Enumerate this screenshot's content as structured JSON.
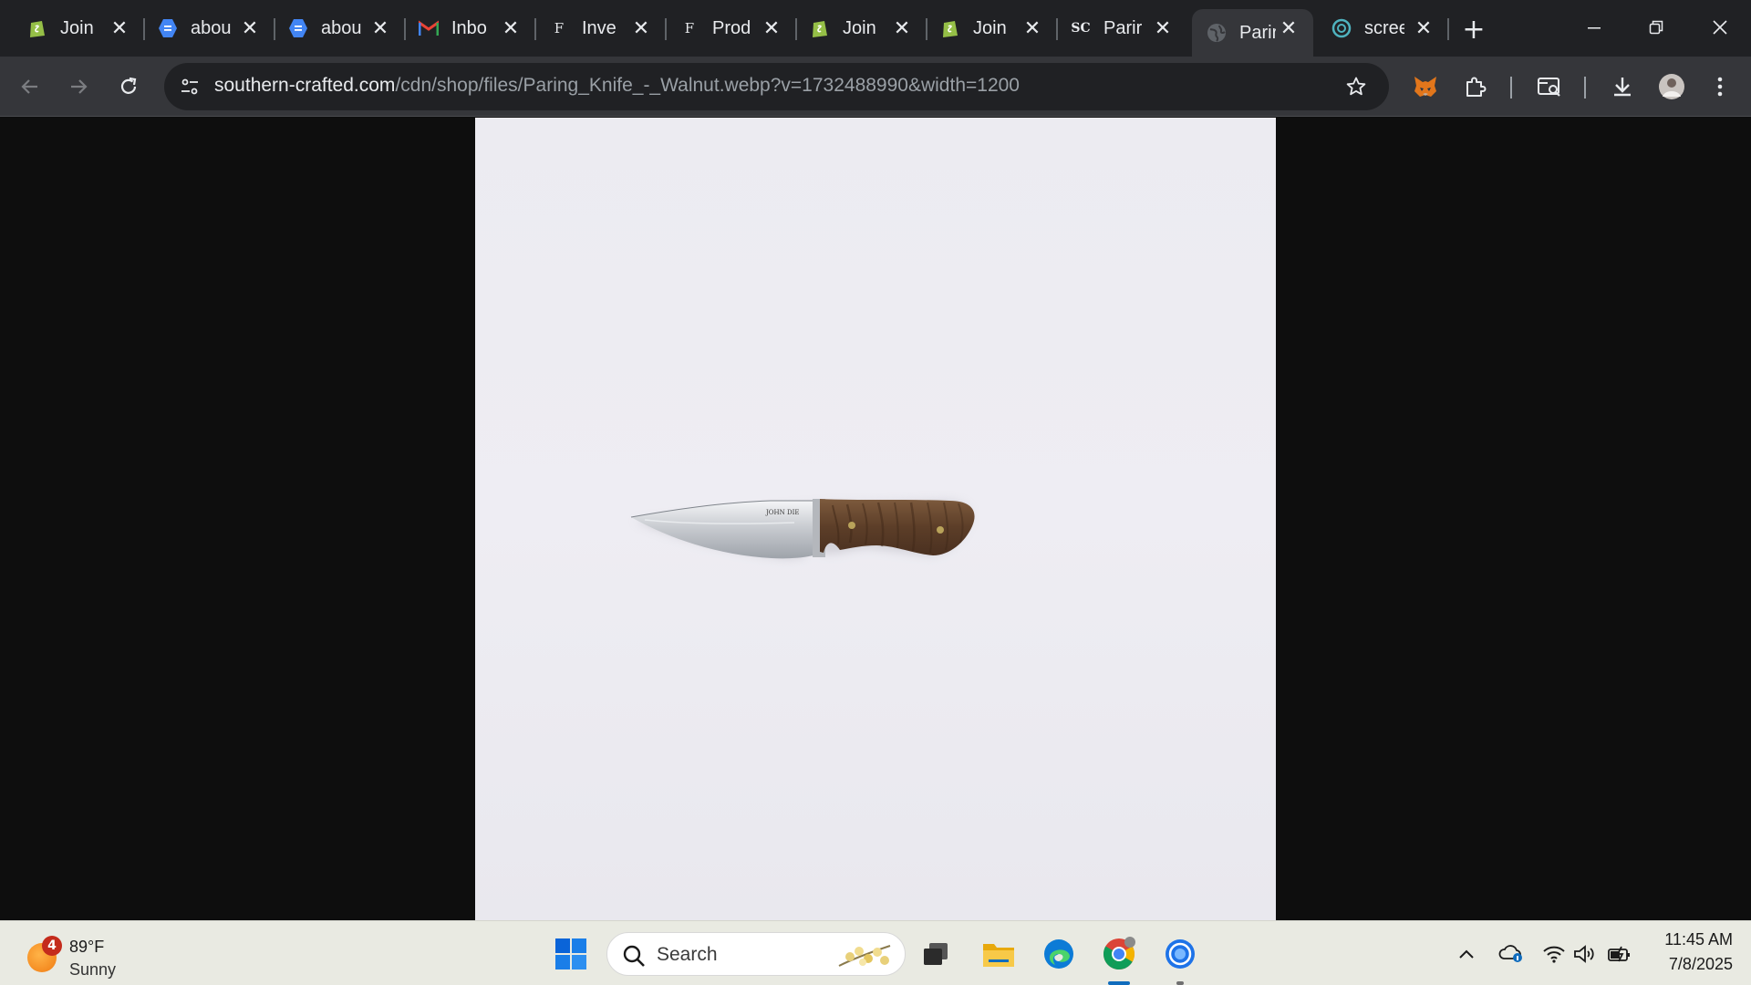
{
  "browser": {
    "tabs": [
      {
        "title": "Join",
        "favicon": "shopify-icon",
        "favicon_color": "#95bf47",
        "active": false
      },
      {
        "title": "abou",
        "favicon": "google-docs-icon",
        "favicon_color": "#4285f4",
        "active": false
      },
      {
        "title": "abou",
        "favicon": "google-docs-icon",
        "favicon_color": "#4285f4",
        "active": false
      },
      {
        "title": "Inbo",
        "favicon": "gmail-icon",
        "favicon_color": "#ea4335",
        "active": false
      },
      {
        "title": "Inve",
        "favicon_text": "F",
        "favicon": "f-icon",
        "active": false
      },
      {
        "title": "Prod",
        "favicon_text": "F",
        "favicon": "f-icon",
        "active": false
      },
      {
        "title": "Join",
        "favicon": "shopify-icon",
        "favicon_color": "#95bf47",
        "active": false
      },
      {
        "title": "Join",
        "favicon": "shopify-icon",
        "favicon_color": "#95bf47",
        "active": false
      },
      {
        "title": "Parir",
        "favicon_text": "SC",
        "favicon": "sc-icon",
        "active": false
      },
      {
        "title": "Parir",
        "favicon": "globe-icon",
        "active": true
      },
      {
        "title": "scree",
        "favicon": "screencast-icon",
        "active": false
      }
    ],
    "new_tab_label": "+",
    "address_bar": {
      "host": "southern-crafted.com",
      "path": "/cdn/shop/files/Paring_Knife_-_Walnut.webp?v=1732488990&width=1200"
    }
  },
  "image": {
    "logo_text": "JOHN DIE",
    "colors": {
      "background": "#ecebf1",
      "blade": "#d9dbdf",
      "handle": "#6b4a32"
    }
  },
  "taskbar": {
    "weather": {
      "badge": "4",
      "temp": "89°F",
      "condition": "Sunny"
    },
    "search_label": "Search",
    "clock": {
      "time": "11:45 AM",
      "date": "7/8/2025"
    }
  }
}
